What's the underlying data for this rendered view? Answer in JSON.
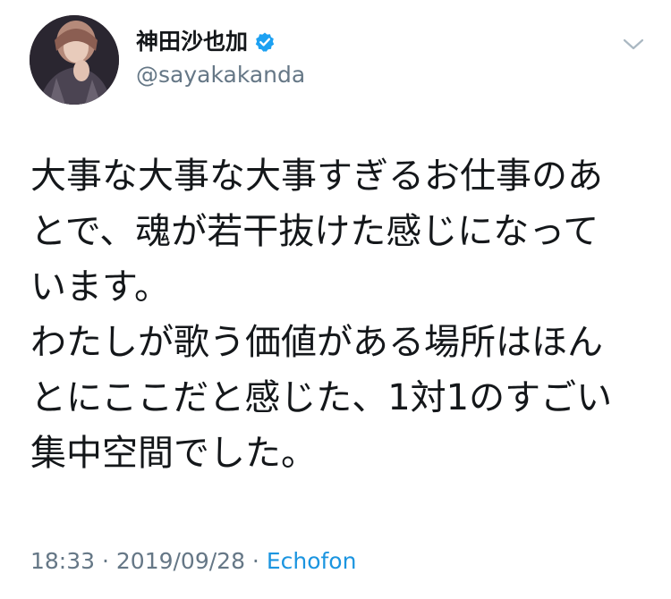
{
  "user": {
    "display_name": "神田沙也加",
    "handle": "@sayakakanda",
    "verified": true
  },
  "tweet": {
    "lines": [
      "大事な大事な大事すぎるお仕事のあ",
      "とで、魂が若干抜けた感じになって",
      "います。",
      "わたしが歌う価値がある場所はほん",
      "とにここだと感じた、1対1のすごい",
      "集中空間でした。"
    ]
  },
  "meta": {
    "time": "18:33",
    "separator_1": " · ",
    "date": "2019/09/28",
    "separator_2": " · ",
    "source": "Echofon"
  },
  "icons": {
    "verified": "verified-badge-icon",
    "menu": "chevron-down-icon"
  },
  "colors": {
    "text": "#14171a",
    "secondary": "#657786",
    "link": "#1b95e0",
    "verified": "#1da1f2"
  }
}
